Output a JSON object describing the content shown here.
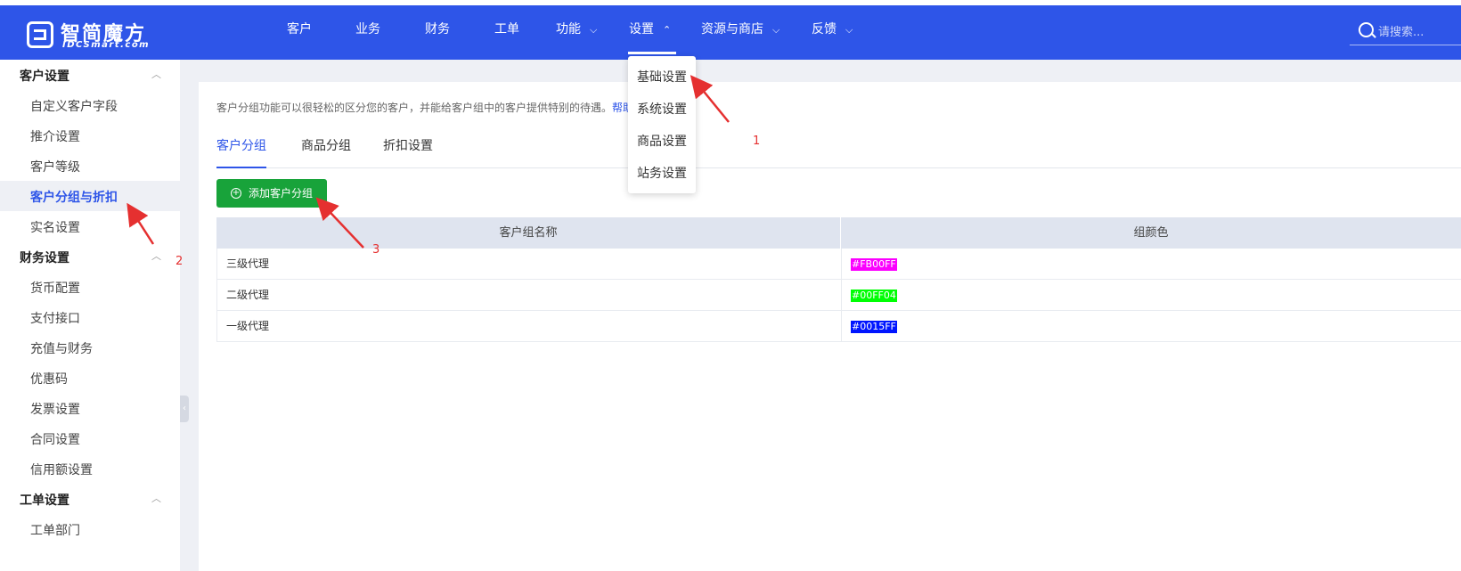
{
  "header": {
    "logo_cn": "智简魔方",
    "logo_en": "IDCSmart.com",
    "nav": [
      {
        "label": "客户"
      },
      {
        "label": "业务"
      },
      {
        "label": "财务"
      },
      {
        "label": "工单"
      },
      {
        "label": "功能",
        "chevron": "⌵"
      },
      {
        "label": "设置",
        "chevron": "⌃"
      },
      {
        "label": "资源与商店",
        "chevron": "⌵"
      },
      {
        "label": "反馈",
        "chevron": "⌵"
      }
    ],
    "search_placeholder": "请搜索..."
  },
  "settings_menu": [
    "基础设置",
    "系统设置",
    "商品设置",
    "站务设置"
  ],
  "sidebar": {
    "groups": [
      {
        "title": "客户设置",
        "items": [
          "自定义客户字段",
          "推介设置",
          "客户等级",
          "客户分组与折扣",
          "实名设置"
        ]
      },
      {
        "title": "财务设置",
        "items": [
          "货币配置",
          "支付接口",
          "充值与财务",
          "优惠码",
          "发票设置",
          "合同设置",
          "信用额设置"
        ]
      },
      {
        "title": "工单设置",
        "items": [
          "工单部门"
        ]
      }
    ],
    "active_item": "客户分组与折扣"
  },
  "main": {
    "description": "客户分组功能可以很轻松的区分您的客户，并能给客户组中的客户提供特别的待遇。",
    "help_link": "帮助",
    "tabs": [
      "客户分组",
      "商品分组",
      "折扣设置"
    ],
    "active_tab": "客户分组",
    "add_button": "添加客户分组",
    "table": {
      "columns": [
        "客户组名称",
        "组颜色"
      ],
      "rows": [
        {
          "name": "三级代理",
          "color": "#FB00FF"
        },
        {
          "name": "二级代理",
          "color": "#00FF04"
        },
        {
          "name": "一级代理",
          "color": "#0015FF"
        }
      ]
    }
  },
  "annotations": [
    "1",
    "2",
    "3"
  ],
  "colors": {
    "header_bg": "#2e55e8",
    "accent": "#2e55e8",
    "add_button_bg": "#18a33a",
    "annotation_red": "#e53030"
  }
}
